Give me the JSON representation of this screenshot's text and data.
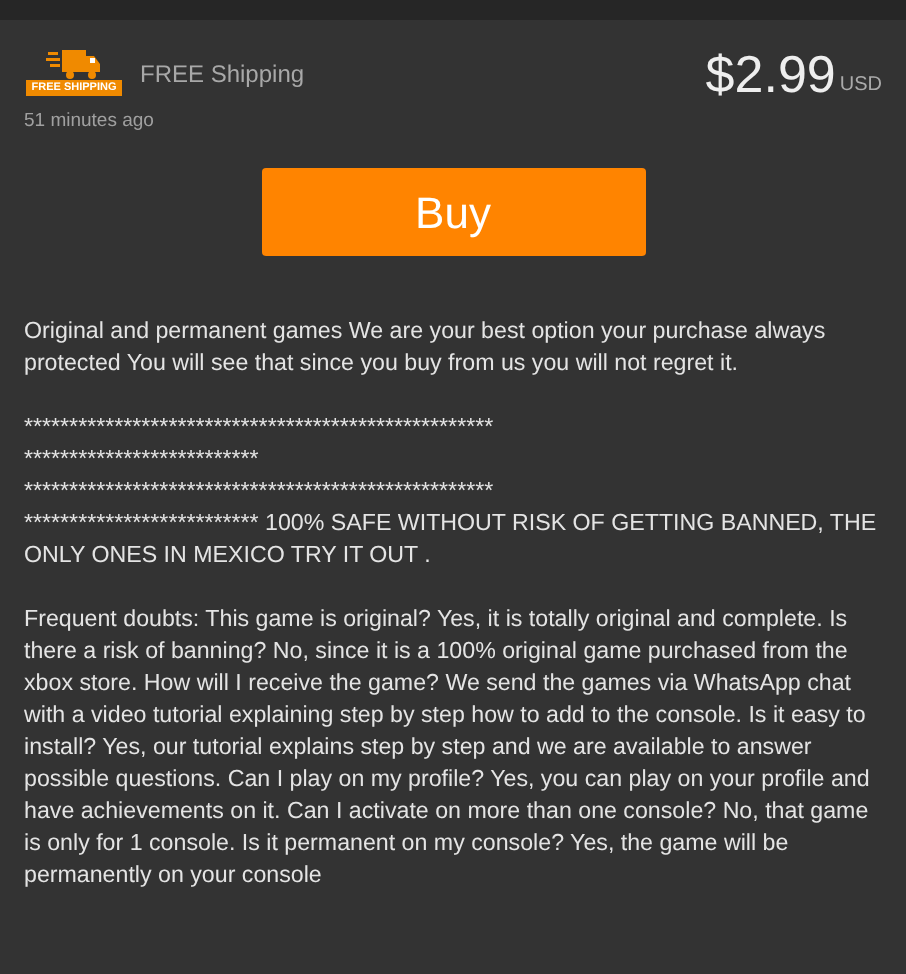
{
  "shipping": {
    "badge_text": "FREE SHIPPING",
    "label": "FREE Shipping"
  },
  "posted": "51 minutes ago",
  "price": {
    "amount": "$2.99",
    "currency": "USD"
  },
  "buy_button": "Buy",
  "description": [
    {
      "lines": [
        "Original and permanent games We are your best option your purchase always protected You will see that since you buy from us you will not regret it."
      ]
    },
    {
      "lines": [
        "****************************************************",
        "**************************",
        "****************************************************",
        "************************** 100% SAFE WITHOUT RISK OF GETTING BANNED, THE ONLY ONES IN MEXICO TRY IT OUT ."
      ]
    },
    {
      "lines": [
        "Frequent doubts: This game is original? Yes, it is totally original and complete. Is there a risk of banning? No, since it is a 100% original game purchased from the xbox store. How will I receive the game? We send the games via WhatsApp chat with a video tutorial explaining step by step how to add to the console. Is it easy to install? Yes, our tutorial explains step by step and we are available to answer possible questions. Can I play on my profile? Yes, you can play on your profile and have achievements on it. Can I activate on more than one console? No, that game is only for 1 console. Is it permanent on my console? Yes, the game will be permanently on your console"
      ]
    }
  ]
}
